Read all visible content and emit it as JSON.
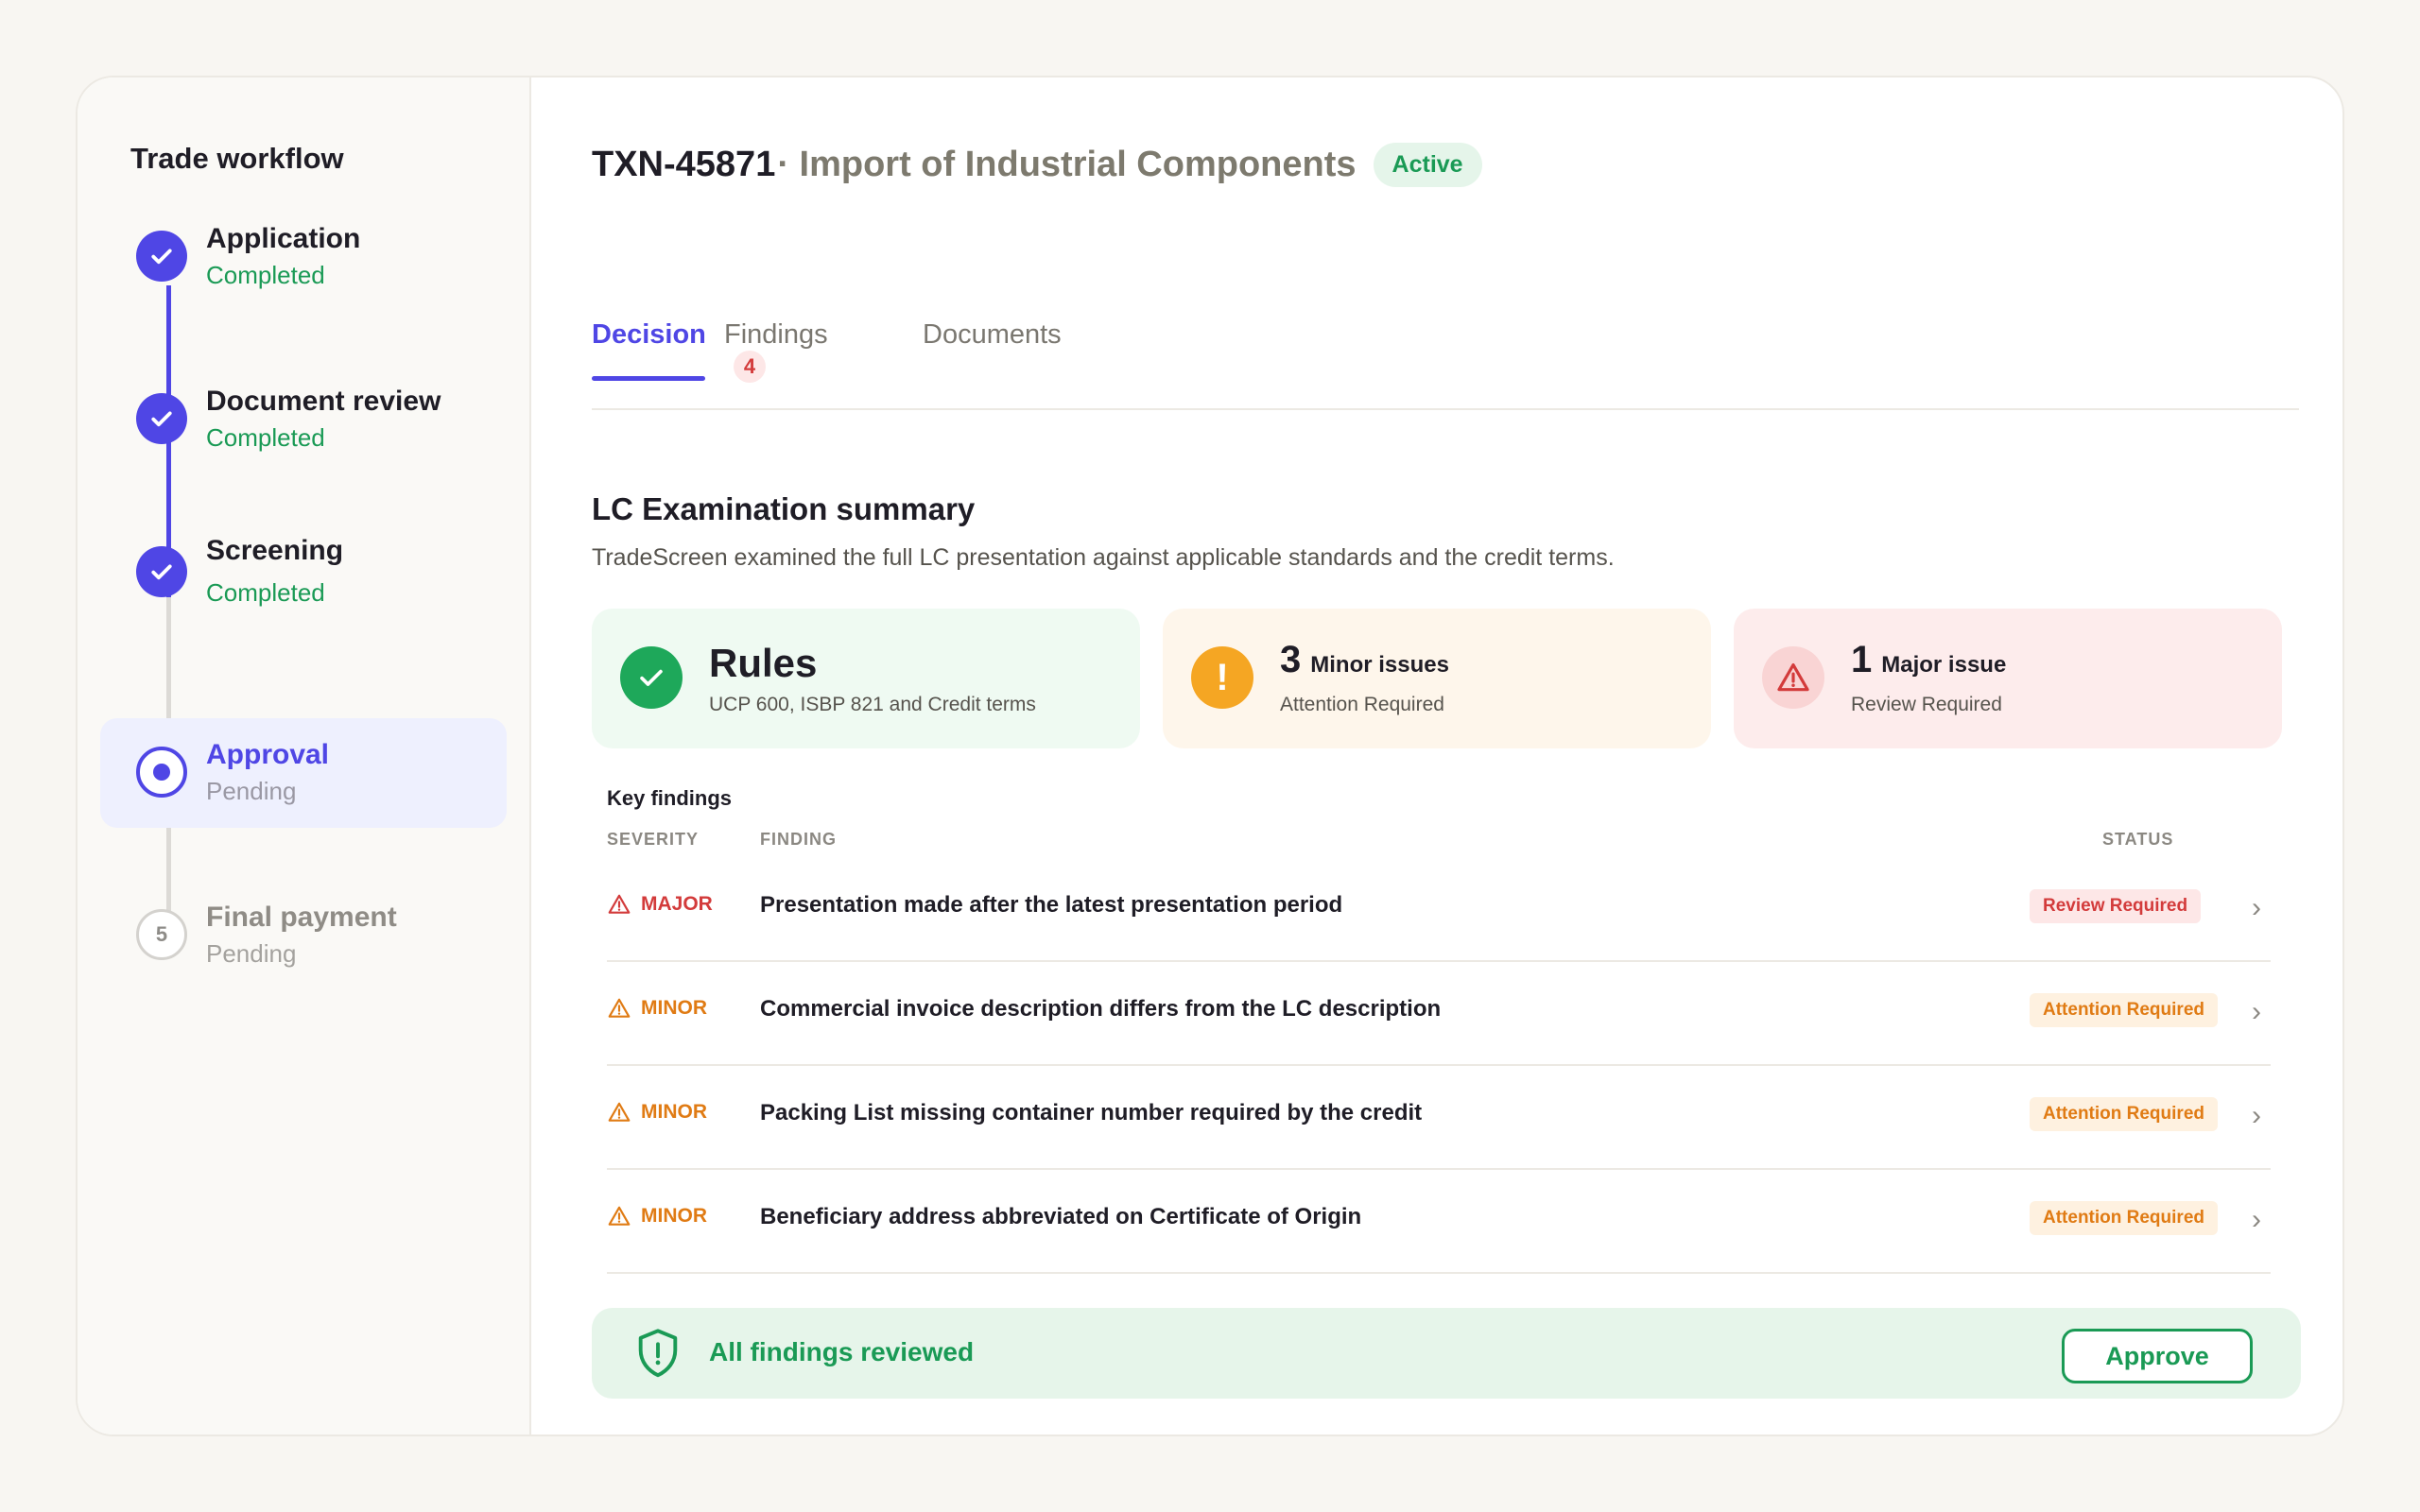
{
  "sidebar": {
    "title": "Trade workflow",
    "steps": [
      {
        "label": "Application",
        "status": "Completed",
        "state": "done"
      },
      {
        "label": "Document review",
        "status": "Completed",
        "state": "done"
      },
      {
        "label": "Screening",
        "status": "Completed",
        "state": "done"
      },
      {
        "label": "Approval",
        "status": "Pending",
        "state": "active"
      },
      {
        "label": "Final payment",
        "status": "Pending",
        "state": "pending",
        "number": "5"
      }
    ]
  },
  "header": {
    "txn_id": "TXN-45871",
    "txn_title": "· Import of Industrial Components",
    "status_badge": "Active"
  },
  "tabs": [
    {
      "label": "Decision",
      "active": true
    },
    {
      "label": "Findings",
      "count": "4"
    },
    {
      "label": "Documents"
    }
  ],
  "summary": {
    "title": "LC Examination summary",
    "description": "TradeScreen examined the full LC presentation against applicable standards and the credit terms.",
    "rules": {
      "title": "Rules",
      "subtitle": "UCP 600, ISBP 821 and Credit terms"
    },
    "minor": {
      "count": "3",
      "label": "Minor issues",
      "subtitle": "Attention Required",
      "icon": "exclamation-icon"
    },
    "major": {
      "count": "1",
      "label": "Major issue",
      "subtitle": "Review Required",
      "icon": "warning-triangle-icon"
    }
  },
  "key_findings": {
    "title": "Key findings",
    "columns": {
      "severity": "SEVERITY",
      "finding": "FINDING",
      "status": "STATUS"
    },
    "rows": [
      {
        "severity": "MAJOR",
        "finding": "Presentation made after the latest presentation period",
        "status": "Review Required"
      },
      {
        "severity": "MINOR",
        "finding": "Commercial invoice description differs from the LC description",
        "status": "Attention Required"
      },
      {
        "severity": "MINOR",
        "finding": "Packing List missing container number required by the credit",
        "status": "Attention Required"
      },
      {
        "severity": "MINOR",
        "finding": "Beneficiary address abbreviated on Certificate of Origin",
        "status": "Attention Required"
      }
    ]
  },
  "footer": {
    "message": "All findings reviewed",
    "approve_label": "Approve"
  },
  "colors": {
    "accent": "#4f46e5",
    "success": "#1a9a55",
    "minor": "#e07b14",
    "major": "#d33b3b"
  }
}
